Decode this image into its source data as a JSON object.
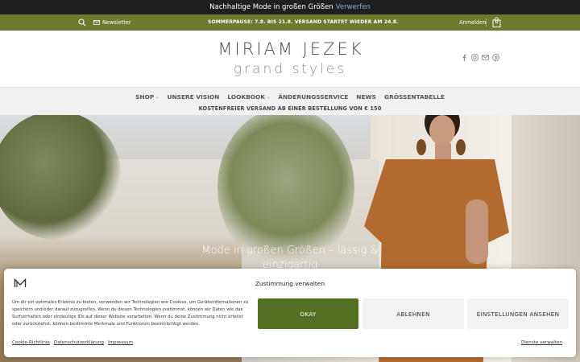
{
  "announcement": {
    "text": "Nachhaltige Mode in großen Größen",
    "dismiss": "Verwerfen"
  },
  "utility_bar": {
    "newsletter": "Newsletter",
    "notice": "SOMMERPAUSE: 7.8. BIS 21.8. VERSAND STARTET WIEDER AM 24.8.",
    "login": "Anmelden",
    "cart_count": "0"
  },
  "brand": {
    "name": "MIRIAM JEZEK",
    "tagline": "grand styles"
  },
  "social_icons": [
    "facebook-icon",
    "instagram-icon",
    "email-icon",
    "pinterest-icon"
  ],
  "nav": {
    "items": [
      {
        "label": "SHOP",
        "has_caret": true
      },
      {
        "label": "UNSERE VISION",
        "has_caret": false
      },
      {
        "label": "LOOKBOOK",
        "has_caret": true
      },
      {
        "label": "ÄNDERUNGSSERVICE",
        "has_caret": false
      },
      {
        "label": "NEWS",
        "has_caret": false
      },
      {
        "label": "GRÖSSENTABELLE",
        "has_caret": false
      }
    ],
    "caret": "⌄",
    "shipping": "KOSTENFREIER VERSAND AB EINER BESTELLUNG VON € 150"
  },
  "hero": {
    "headline_line1": "Mode in großen Größen – lässig &",
    "headline_line2": "einzigartig"
  },
  "cookie": {
    "title": "Zustimmung verwalten",
    "body": "Um dir ein optimales Erlebnis zu bieten, verwenden wir Technologien wie Cookies, um Geräteinformationen zu speichern und/oder darauf zuzugreifen. Wenn du diesen Technologien zustimmst, können wir Daten wie das Surfverhalten oder eindeutige IDs auf dieser Website verarbeiten. Wenn du deine Zustimmung nicht erteilst oder zurückziehst, können bestimmte Merkmale und Funktionen beeinträchtigt werden.",
    "accept": "OKAY",
    "deny": "ABLEHNEN",
    "settings": "EINSTELLUNGEN ANSEHEN",
    "links": [
      "Cookie-Richtlinie",
      "Datenschutzerklärung",
      "Impressum"
    ],
    "services": "Dienste verwalten"
  },
  "colors": {
    "green": "#6b7a2c",
    "button_green": "#567023",
    "dark": "#1f1f1f"
  }
}
